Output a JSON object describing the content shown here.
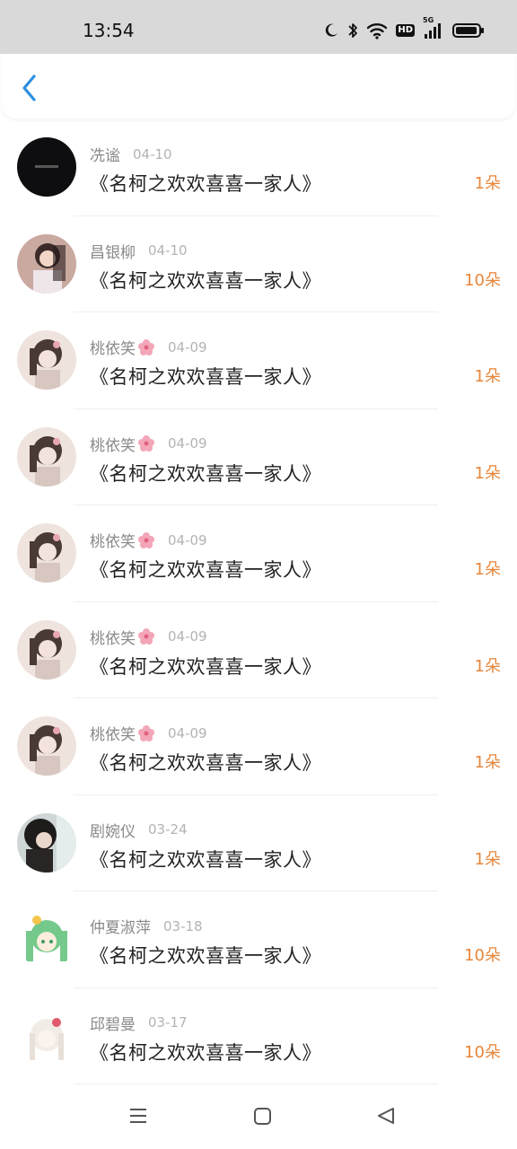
{
  "status_bar": {
    "time": "13:54",
    "icons": [
      "moon-icon",
      "bluetooth-icon",
      "wifi-icon",
      "hd-icon",
      "5g-signal-icon",
      "battery-icon"
    ],
    "hd_label": "HD",
    "network_label": "5G"
  },
  "header": {
    "back_icon": "chevron-left-icon",
    "accent_color": "#2d8fe0"
  },
  "records": [
    {
      "name": "冼谧",
      "date": "04-10",
      "title": "《名柯之欢欢喜喜一家人》",
      "amount": "1朵",
      "flower": false
    },
    {
      "name": "昌银柳",
      "date": "04-10",
      "title": "《名柯之欢欢喜喜一家人》",
      "amount": "10朵",
      "flower": false
    },
    {
      "name": "桃依笑",
      "date": "04-09",
      "title": "《名柯之欢欢喜喜一家人》",
      "amount": "1朵",
      "flower": true
    },
    {
      "name": "桃依笑",
      "date": "04-09",
      "title": "《名柯之欢欢喜喜一家人》",
      "amount": "1朵",
      "flower": true
    },
    {
      "name": "桃依笑",
      "date": "04-09",
      "title": "《名柯之欢欢喜喜一家人》",
      "amount": "1朵",
      "flower": true
    },
    {
      "name": "桃依笑",
      "date": "04-09",
      "title": "《名柯之欢欢喜喜一家人》",
      "amount": "1朵",
      "flower": true
    },
    {
      "name": "桃依笑",
      "date": "04-09",
      "title": "《名柯之欢欢喜喜一家人》",
      "amount": "1朵",
      "flower": true
    },
    {
      "name": "剧婉仪",
      "date": "03-24",
      "title": "《名柯之欢欢喜喜一家人》",
      "amount": "1朵",
      "flower": false
    },
    {
      "name": "仲夏淑萍",
      "date": "03-18",
      "title": "《名柯之欢欢喜喜一家人》",
      "amount": "10朵",
      "flower": false
    },
    {
      "name": "邱碧曼",
      "date": "03-17",
      "title": "《名柯之欢欢喜喜一家人》",
      "amount": "10朵",
      "flower": false
    }
  ],
  "colors": {
    "amount": "#e8863a",
    "name": "#8a8a8a",
    "date": "#b3b3b3",
    "title": "#222222"
  },
  "nav_bar": {
    "icons": [
      "menu-icon",
      "home-square-icon",
      "back-triangle-icon"
    ]
  }
}
